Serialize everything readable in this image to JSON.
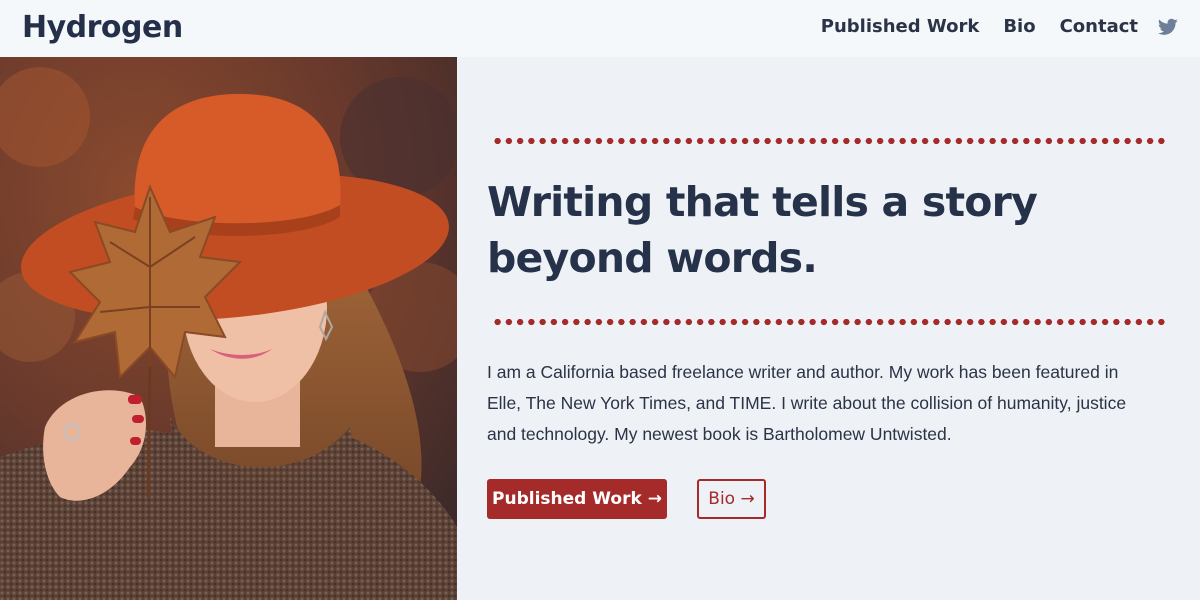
{
  "brand": {
    "name": "Hydrogen"
  },
  "nav": {
    "items": [
      {
        "label": "Published Work"
      },
      {
        "label": "Bio"
      },
      {
        "label": "Contact"
      }
    ],
    "social_icon": "twitter-icon"
  },
  "hero": {
    "headline": "Writing that tells a story beyond words.",
    "intro": "I am a California based freelance writer and author. My work has been featured in Elle, The New York Times, and TIME. I write about the collision of humanity, justice and technology. My newest book is Bartholomew Untwisted.",
    "primary_button": "Published Work →",
    "secondary_button": "Bio →",
    "photo_icon": "portrait-photo"
  },
  "colors": {
    "accent": "#a52a2a",
    "text": "#26324a",
    "background": "#eef2f6",
    "topbar": "#f5f8fb",
    "twitter": "#6e7f99"
  }
}
